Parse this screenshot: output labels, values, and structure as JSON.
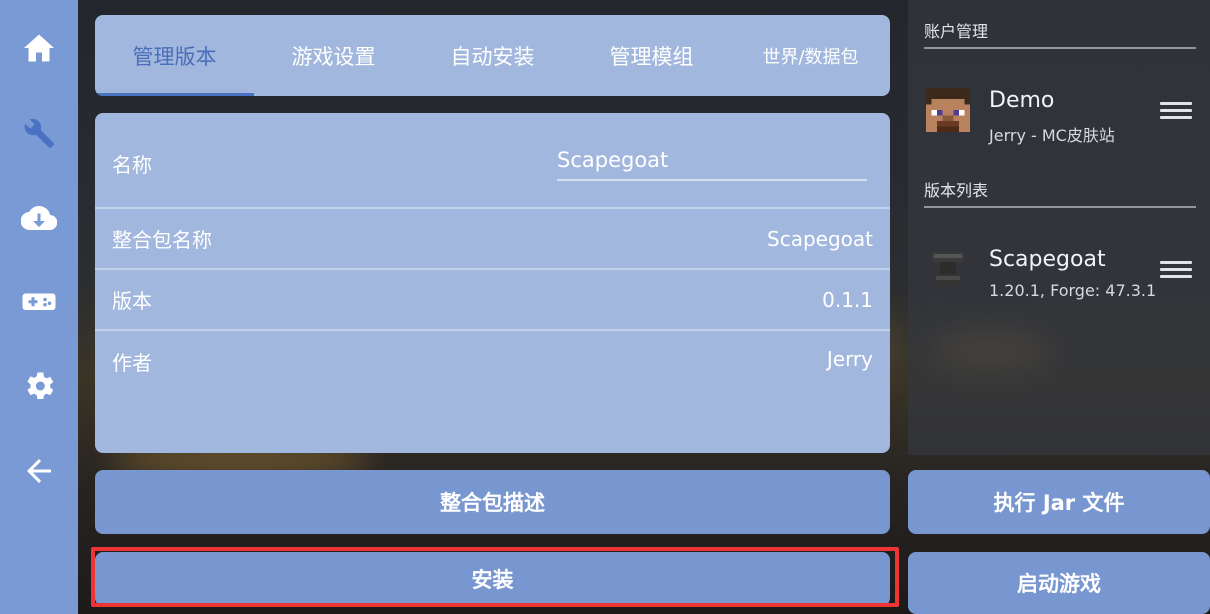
{
  "nav": {
    "items": [
      {
        "icon": "home-icon"
      },
      {
        "icon": "wrench-icon"
      },
      {
        "icon": "cloud-download-icon"
      },
      {
        "icon": "gamepad-icon"
      },
      {
        "icon": "gear-icon"
      },
      {
        "icon": "back-arrow-icon"
      }
    ]
  },
  "tabs": [
    {
      "label": "管理版本",
      "active": true
    },
    {
      "label": "游戏设置"
    },
    {
      "label": "自动安装"
    },
    {
      "label": "管理模组"
    },
    {
      "label": "世界/数据包"
    }
  ],
  "info": {
    "name_label": "名称",
    "name_value": "Scapegoat",
    "modpack_name_label": "整合包名称",
    "modpack_name_value": "Scapegoat",
    "version_label": "版本",
    "version_value": "0.1.1",
    "author_label": "作者",
    "author_value": "Jerry"
  },
  "actions": {
    "description_label": "整合包描述",
    "install_label": "安装"
  },
  "sidebar": {
    "account_section": "账户管理",
    "account": {
      "name": "Demo",
      "sub": "Jerry - MC皮肤站"
    },
    "versions_section": "版本列表",
    "version": {
      "name": "Scapegoat",
      "sub": "1.20.1, Forge: 47.3.1"
    },
    "run_jar_label": "执行 Jar 文件",
    "launch_label": "启动游戏"
  },
  "colors": {
    "accent": "#7897d0",
    "panel": "#a2b7de",
    "rail": "#7a9ad6",
    "highlight": "#ee3535"
  }
}
